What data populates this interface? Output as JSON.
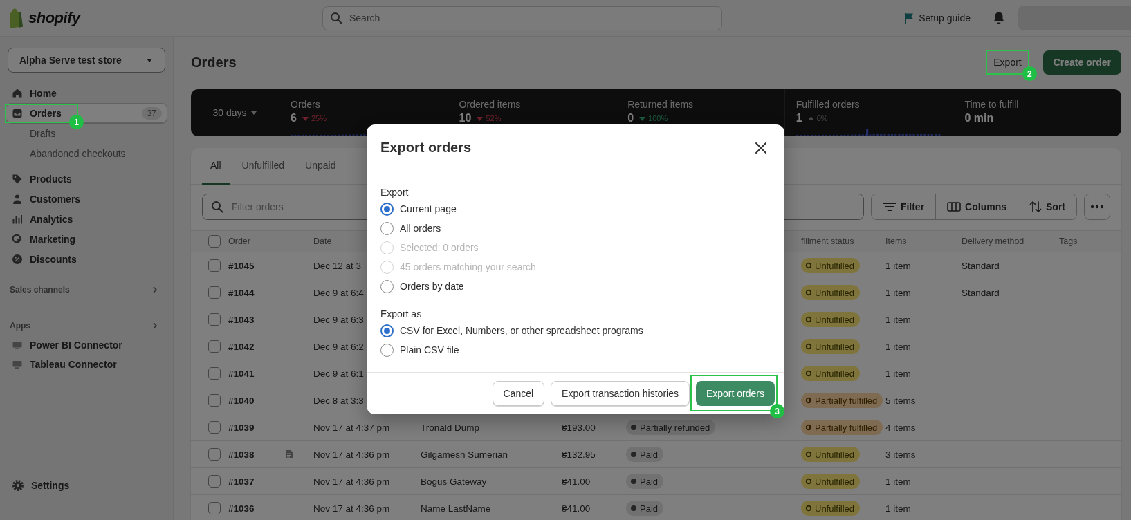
{
  "topbar": {
    "brand": "shopify",
    "search_placeholder": "Search",
    "setup_guide": "Setup guide"
  },
  "sidebar": {
    "store": "Alpha Serve test store",
    "nav": [
      {
        "label": "Home",
        "selected": false
      },
      {
        "label": "Orders",
        "selected": true,
        "count": "37",
        "step": "1",
        "children": [
          {
            "label": "Drafts",
            "selected": false
          },
          {
            "label": "Abandoned checkouts",
            "selected": false
          }
        ]
      },
      {
        "label": "Products",
        "selected": false
      },
      {
        "label": "Customers",
        "selected": false
      },
      {
        "label": "Analytics",
        "selected": false
      },
      {
        "label": "Marketing",
        "selected": false
      },
      {
        "label": "Discounts",
        "selected": false
      }
    ],
    "sections": [
      {
        "title": "Sales channels"
      },
      {
        "title": "Apps",
        "items": [
          {
            "label": "Power BI Connector"
          },
          {
            "label": "Tableau Connector"
          }
        ]
      }
    ],
    "settings": {
      "label": "Settings"
    }
  },
  "page": {
    "title": "Orders",
    "actions": [
      {
        "label": "Export",
        "kind": "plain",
        "step": "2"
      },
      {
        "label": "Create order",
        "kind": "primary"
      }
    ]
  },
  "stats": {
    "period": "30 days",
    "metrics": [
      {
        "label": "Orders",
        "value": "6",
        "change": "25%",
        "kind": "worsened"
      },
      {
        "label": "Ordered items",
        "value": "10",
        "change": "52%",
        "kind": "worsened"
      },
      {
        "label": "Returned items",
        "value": "0",
        "change": "100%",
        "kind": "improved"
      },
      {
        "label": "Fulfilled orders",
        "value": "1",
        "change": "0%",
        "kind": "flat"
      },
      {
        "label": "Time to fulfill",
        "value": "0 min"
      }
    ]
  },
  "orders": {
    "tabs": [
      {
        "label": "All",
        "selected": true
      },
      {
        "label": "Unfulfilled",
        "selected": false
      },
      {
        "label": "Unpaid",
        "selected": false
      }
    ],
    "filter_placeholder": "Filter orders",
    "tools": [
      "Filter",
      "Columns",
      "Sort"
    ],
    "header": {
      "checked": false,
      "order": "Order",
      "date": "Date",
      "fulfillment": "fillment status",
      "items": "Items",
      "delivery": "Delivery method",
      "tags": "Tags"
    },
    "rows": [
      {
        "checked": false,
        "order": "#1045",
        "date": "Dec 12 at 3",
        "fulfillment": {
          "label": "Unfulfilled",
          "kind": "unfulfilled"
        },
        "items": "1 item",
        "delivery": "Standard"
      },
      {
        "checked": false,
        "order": "#1044",
        "date": "Dec 9 at 6:4",
        "fulfillment": {
          "label": "Unfulfilled",
          "kind": "unfulfilled"
        },
        "items": "1 item",
        "delivery": "Standard"
      },
      {
        "checked": false,
        "order": "#1043",
        "date": "Dec 9 at 6:3",
        "fulfillment": {
          "label": "Unfulfilled",
          "kind": "unfulfilled"
        },
        "items": "1 item"
      },
      {
        "checked": false,
        "order": "#1042",
        "date": "Dec 9 at 6:2",
        "fulfillment": {
          "label": "Unfulfilled",
          "kind": "unfulfilled"
        },
        "items": "1 item"
      },
      {
        "checked": false,
        "order": "#1041",
        "date": "Dec 9 at 6:1",
        "fulfillment": {
          "label": "Unfulfilled",
          "kind": "unfulfilled"
        },
        "items": "1 item"
      },
      {
        "checked": false,
        "order": "#1040",
        "date": "Dec 8 at 3:3",
        "fulfillment": {
          "label": "Partially fulfilled",
          "kind": "partial"
        },
        "items": "5 items"
      },
      {
        "checked": false,
        "order": "#1039",
        "date": "Nov 17 at 4:37 pm",
        "customer": "Tronald Dump",
        "total": "₴193.00",
        "payment": {
          "label": "Partially refunded",
          "kind": "neutral"
        },
        "fulfillment": {
          "label": "Partially fulfilled",
          "kind": "partial"
        },
        "items": "4 items"
      },
      {
        "checked": false,
        "order": "#1038",
        "note": true,
        "date": "Nov 17 at 4:36 pm",
        "customer": "Gilgamesh Sumerian",
        "total": "₴132.95",
        "payment": {
          "label": "Paid",
          "kind": "neutral"
        },
        "fulfillment": {
          "label": "Unfulfilled",
          "kind": "unfulfilled"
        },
        "items": "3 items"
      },
      {
        "checked": false,
        "order": "#1037",
        "date": "Nov 17 at 4:36 pm",
        "customer": "Bogus Gateway",
        "total": "₴41.00",
        "payment": {
          "label": "Paid",
          "kind": "neutral"
        },
        "fulfillment": {
          "label": "Unfulfilled",
          "kind": "unfulfilled"
        },
        "items": "1 item"
      },
      {
        "checked": false,
        "order": "#1036",
        "date": "Nov 17 at 4:36 pm",
        "customer": "Name LastName",
        "total": "₴41.00",
        "payment": {
          "label": "Paid",
          "kind": "neutral"
        },
        "fulfillment": {
          "label": "Unfulfilled",
          "kind": "unfulfilled"
        },
        "items": "1 item"
      }
    ]
  },
  "modal": {
    "title": "Export orders",
    "groups": [
      {
        "label": "Export",
        "options": [
          {
            "label": "Current page",
            "selected": true,
            "disabled": false
          },
          {
            "label": "All orders",
            "selected": false,
            "disabled": false
          },
          {
            "label": "Selected: 0 orders",
            "selected": false,
            "disabled": true
          },
          {
            "label": "45 orders matching your search",
            "selected": false,
            "disabled": true
          },
          {
            "label": "Orders by date",
            "selected": false,
            "disabled": false
          }
        ]
      },
      {
        "label": "Export as",
        "options": [
          {
            "label": "CSV for Excel, Numbers, or other spreadsheet programs",
            "selected": true,
            "disabled": false
          },
          {
            "label": "Plain CSV file",
            "selected": false,
            "disabled": false
          }
        ]
      }
    ],
    "buttons": [
      {
        "label": "Cancel",
        "kind": "secondary"
      },
      {
        "label": "Export transaction histories",
        "kind": "secondary"
      },
      {
        "label": "Export orders",
        "kind": "primary",
        "step": "3"
      }
    ]
  }
}
